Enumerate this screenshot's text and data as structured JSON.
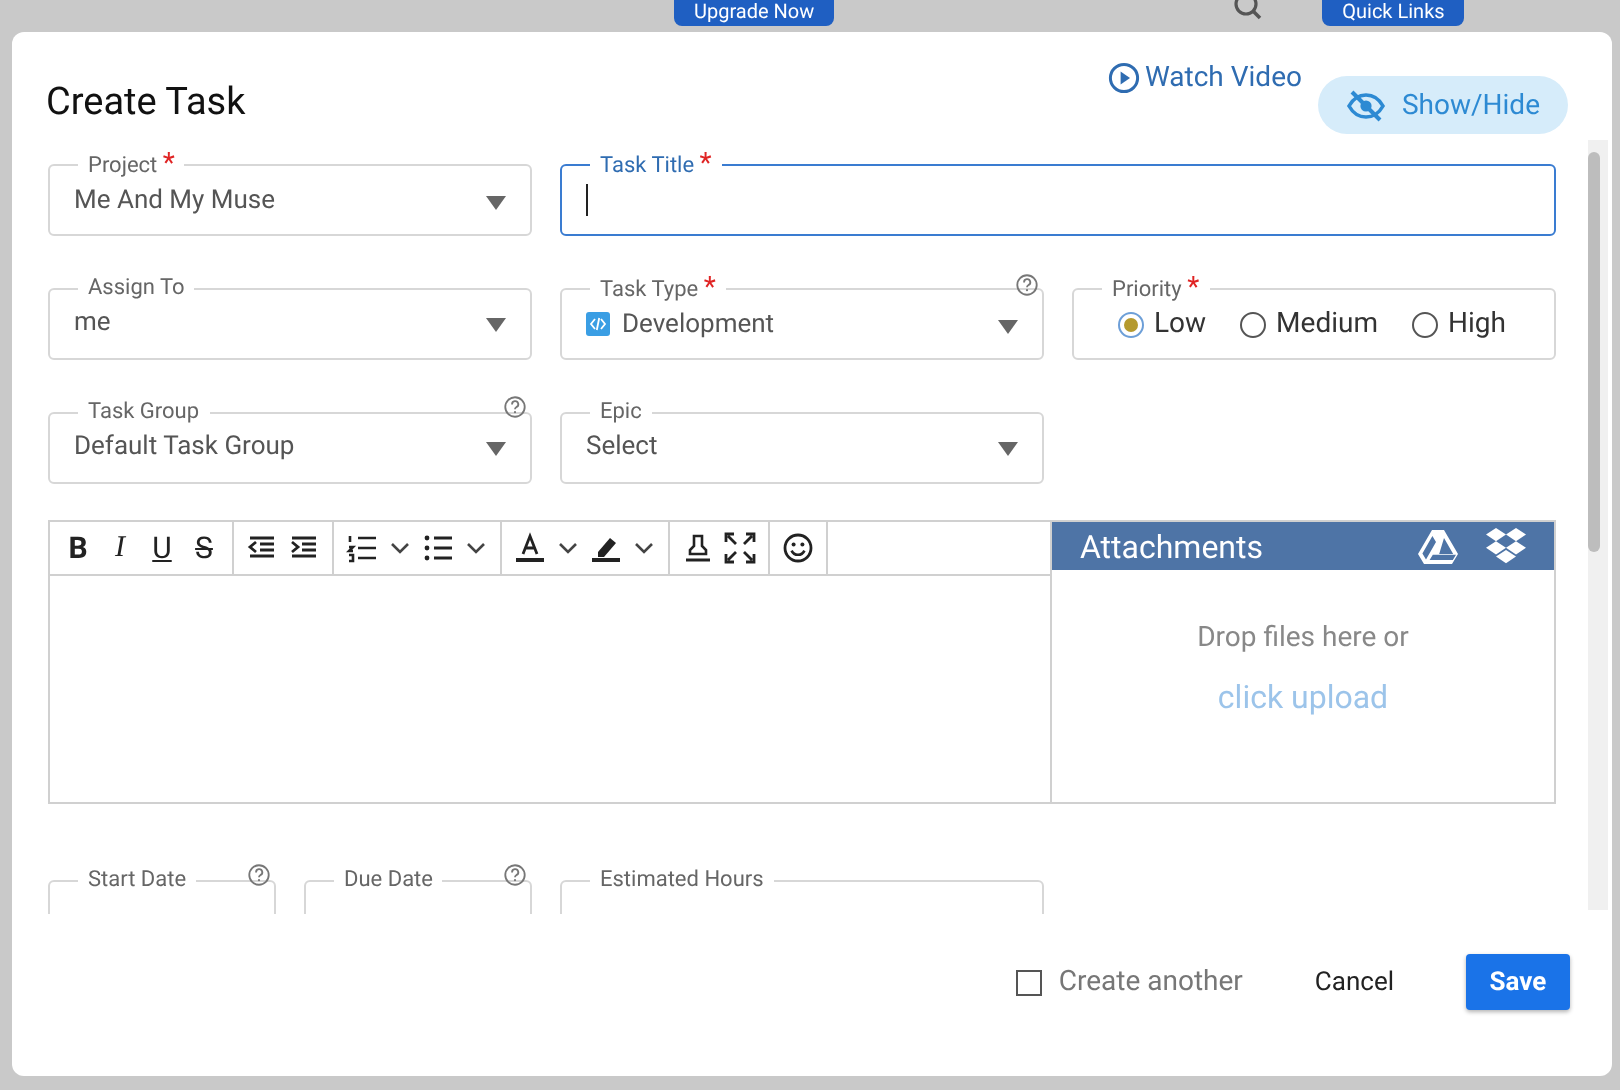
{
  "backdrop": {
    "buttons": [
      "Upgrade Now",
      "Quick Links"
    ]
  },
  "dialog": {
    "title": "Create Task",
    "watch_video": "Watch Video",
    "show_hide": "Show/Hide"
  },
  "fields": [
    {
      "kind": "select",
      "label": "Project",
      "required_mark": "*",
      "value": "Me And My Muse",
      "focused": false
    },
    {
      "kind": "text",
      "label": "Task Title",
      "required_mark": "*",
      "focused": true,
      "wide": true
    },
    {
      "kind": "select",
      "label": "Assign To",
      "value": "me",
      "focused": false
    },
    {
      "kind": "select",
      "label": "Task Type",
      "required_mark": "*",
      "value": "Development",
      "focused": false,
      "help": true,
      "type_icon": true
    },
    {
      "kind": "radio",
      "label": "Priority",
      "required_mark": "*",
      "options": [
        {
          "label": "Low",
          "selected": true
        },
        {
          "label": "Medium",
          "selected": false
        },
        {
          "label": "High",
          "selected": false
        }
      ]
    },
    {
      "kind": "select",
      "label": "Task Group",
      "value": "Default Task Group",
      "focused": false,
      "help": true
    },
    {
      "kind": "select",
      "label": "Epic",
      "value": "Select",
      "focused": false
    }
  ],
  "toolbar": [
    [
      {
        "kind": "bold",
        "label": "B"
      },
      {
        "kind": "italic",
        "label": "I"
      },
      {
        "kind": "underline",
        "label": "U"
      },
      {
        "kind": "strike",
        "label": "S"
      }
    ],
    [
      {
        "kind": "outdent"
      },
      {
        "kind": "indent"
      }
    ],
    [
      {
        "kind": "ordered-list"
      },
      {
        "kind": "caret"
      },
      {
        "kind": "bullet-list"
      },
      {
        "kind": "caret"
      }
    ],
    [
      {
        "kind": "text-color"
      },
      {
        "kind": "caret"
      },
      {
        "kind": "highlight"
      },
      {
        "kind": "caret"
      }
    ],
    [
      {
        "kind": "stamp"
      },
      {
        "kind": "fullscreen"
      }
    ],
    [
      {
        "kind": "emoji"
      }
    ]
  ],
  "attachments": {
    "title": "Attachments",
    "drop_text": "Drop files here or",
    "upload_link": "click upload"
  },
  "date_fields": [
    {
      "label": "Start Date",
      "help": true
    },
    {
      "label": "Due Date",
      "help": true
    },
    {
      "label": "Estimated Hours",
      "help": false
    }
  ],
  "footer": {
    "create_another": {
      "label": "Create another",
      "checked": false
    },
    "cancel": "Cancel",
    "save": "Save"
  }
}
